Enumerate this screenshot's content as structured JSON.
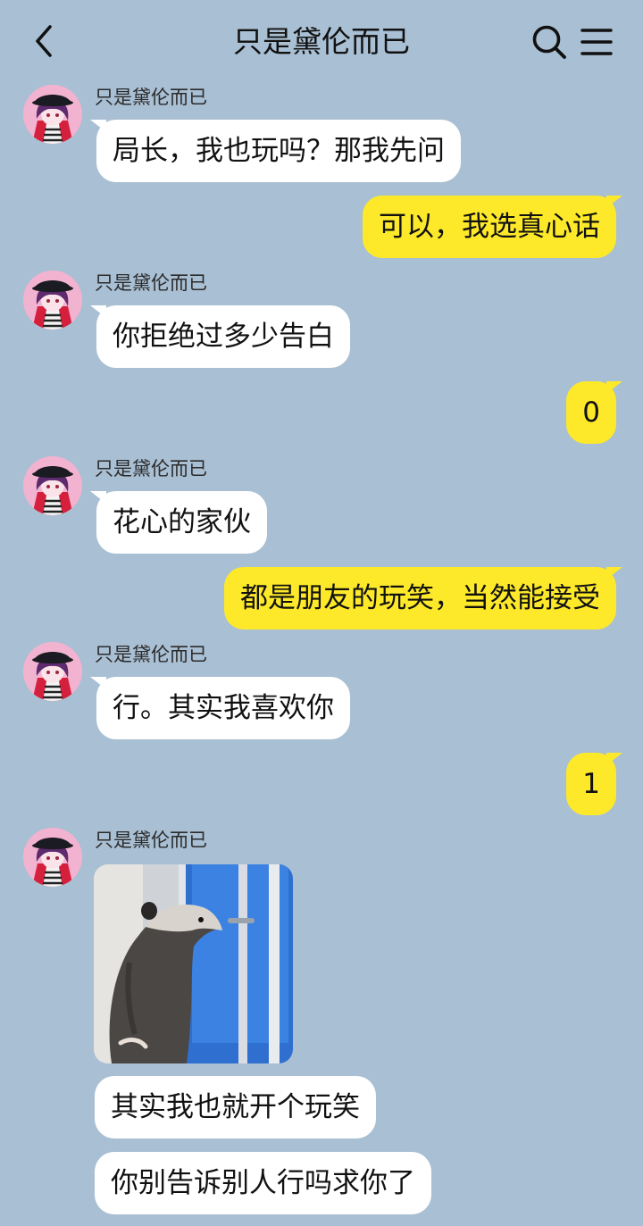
{
  "header": {
    "title": "只是黛伦而已",
    "back_icon": "chevron-left-icon",
    "search_icon": "search-icon",
    "menu_icon": "hamburger-menu-icon"
  },
  "colors": {
    "background": "#a9bfd3",
    "incoming_bubble": "#ffffff",
    "outgoing_bubble": "#fde92a"
  },
  "messages": [
    {
      "from": "other",
      "sender": "只是黛伦而已",
      "text": "局长，我也玩吗？那我先问"
    },
    {
      "from": "me",
      "text": "可以，我选真心话"
    },
    {
      "from": "other",
      "sender": "只是黛伦而已",
      "text": "你拒绝过多少告白"
    },
    {
      "from": "me",
      "text": "0"
    },
    {
      "from": "other",
      "sender": "只是黛伦而已",
      "text": "花心的家伙"
    },
    {
      "from": "me",
      "text": "都是朋友的玩笑，当然能接受"
    },
    {
      "from": "other",
      "sender": "只是黛伦而已",
      "text": "行。其实我喜欢你"
    },
    {
      "from": "me",
      "text": "1"
    },
    {
      "from": "other",
      "sender": "只是黛伦而已",
      "type": "image",
      "image": "opossum-at-window-sticker"
    },
    {
      "from": "other",
      "text": "其实我也就开个玩笑"
    },
    {
      "from": "other",
      "text": "你别告诉别人行吗求你了"
    }
  ]
}
